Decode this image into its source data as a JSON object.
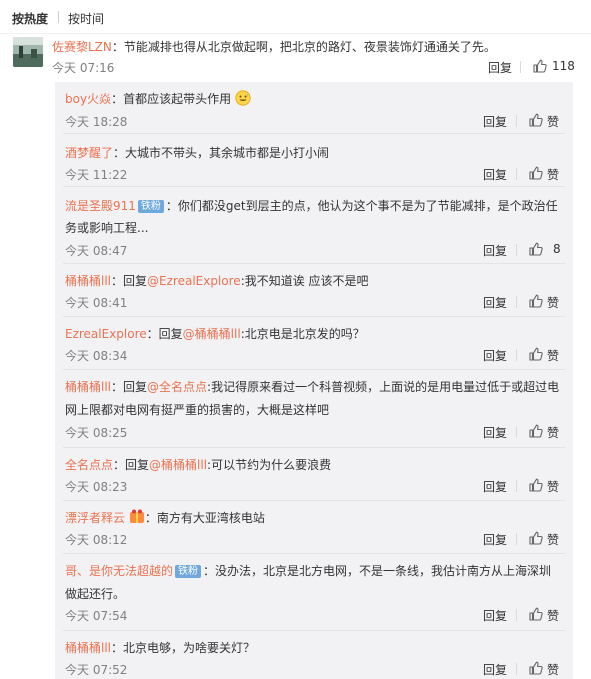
{
  "sort": {
    "hot_label": "按热度",
    "time_label": "按时间"
  },
  "actions": {
    "reply_label": "回复",
    "like_label": "赞"
  },
  "main_comment": {
    "username": "佐赛黎LZN",
    "text": "：节能减排也得从北京做起啊，把北京的路灯、夜景装饰灯通通关了先。",
    "time": "今天 07:16",
    "likes": "118"
  },
  "replies": [
    {
      "username": "boy火焱",
      "text": "：首都应该起带头作用",
      "emoji": "grinning-face-emoji",
      "time": "今天 18:28",
      "likes": ""
    },
    {
      "username": "酒梦醒了",
      "text": "：大城市不带头，其余城市都是小打小闹",
      "time": "今天 11:22",
      "likes": ""
    },
    {
      "username": "流是圣殿911",
      "badge": "铁粉",
      "text_line1": "：你们都没get到层主的点，他认为这个事不是为了节能减排，是个政治任",
      "text_line2": "务或影响工程...",
      "time": "今天 08:47",
      "likes": "8"
    },
    {
      "username": "桶桶桶lll",
      "prefix": "：回复",
      "mention": "@EzrealExplore",
      "text": ":我不知道诶 应该不是吧",
      "time": "今天 08:41",
      "likes": ""
    },
    {
      "username": "EzrealExplore",
      "prefix": "：回复",
      "mention": "@桶桶桶lll",
      "text": ":北京电是北京发的吗？",
      "time": "今天 08:34",
      "likes": ""
    },
    {
      "username": "桶桶桶lll",
      "prefix": "：回复",
      "mention": "@全名点点",
      "text_line1": ":我记得原来看过一个科普视频，上面说的是用电量过低于或超过电",
      "text_line2": "网上限都对电网有挺严重的损害的，大概是这样吧",
      "time": "今天 08:25",
      "likes": ""
    },
    {
      "username": "全名点点",
      "prefix": "：回复",
      "mention": "@桶桶桶lll",
      "text": ":可以节约为什么要浪费",
      "time": "今天 08:23",
      "likes": ""
    },
    {
      "username": "漂浮者释云",
      "emoji": "gift-badge-icon",
      "text": "：南方有大亚湾核电站",
      "time": "今天 08:12",
      "likes": ""
    },
    {
      "username": "哥、是你无法超越的",
      "badge": "铁粉",
      "text_line1": "：没办法，北京是北方电网，不是一条线，我估计南方从上海深圳",
      "text_line2": "做起还行。",
      "time": "今天 07:54",
      "likes": ""
    },
    {
      "username": "桶桶桶lll",
      "text": "：北京电够，为啥要关灯？",
      "time": "今天 07:52",
      "likes": ""
    }
  ],
  "colors": {
    "username": "#eb7350",
    "panel_bg": "#f2f2f5",
    "badge": "#6fa8dc"
  }
}
